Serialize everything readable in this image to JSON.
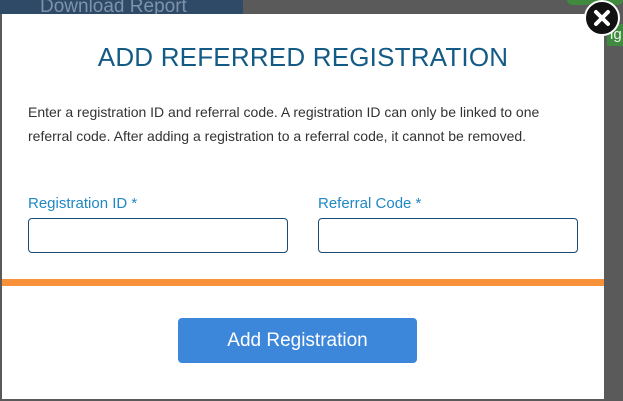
{
  "background": {
    "download_button_label": "Download Report",
    "right_edge_button_label": "ig"
  },
  "modal": {
    "title": "ADD REFERRED REGISTRATION",
    "instructions": "Enter a registration ID and referral code. A registration ID can only be linked to one referral code. After adding a registration to a referral code, it cannot be removed.",
    "fields": {
      "registration_id": {
        "label": "Registration ID *",
        "value": "",
        "placeholder": ""
      },
      "referral_code": {
        "label": "Referral Code *",
        "value": "",
        "placeholder": ""
      }
    },
    "submit_label": "Add Registration",
    "close_icon": "close-icon"
  },
  "colors": {
    "title": "#135b86",
    "label": "#2088c4",
    "divider": "#f7923a",
    "button": "#3d87db",
    "overlay": "#5a5a5a"
  }
}
